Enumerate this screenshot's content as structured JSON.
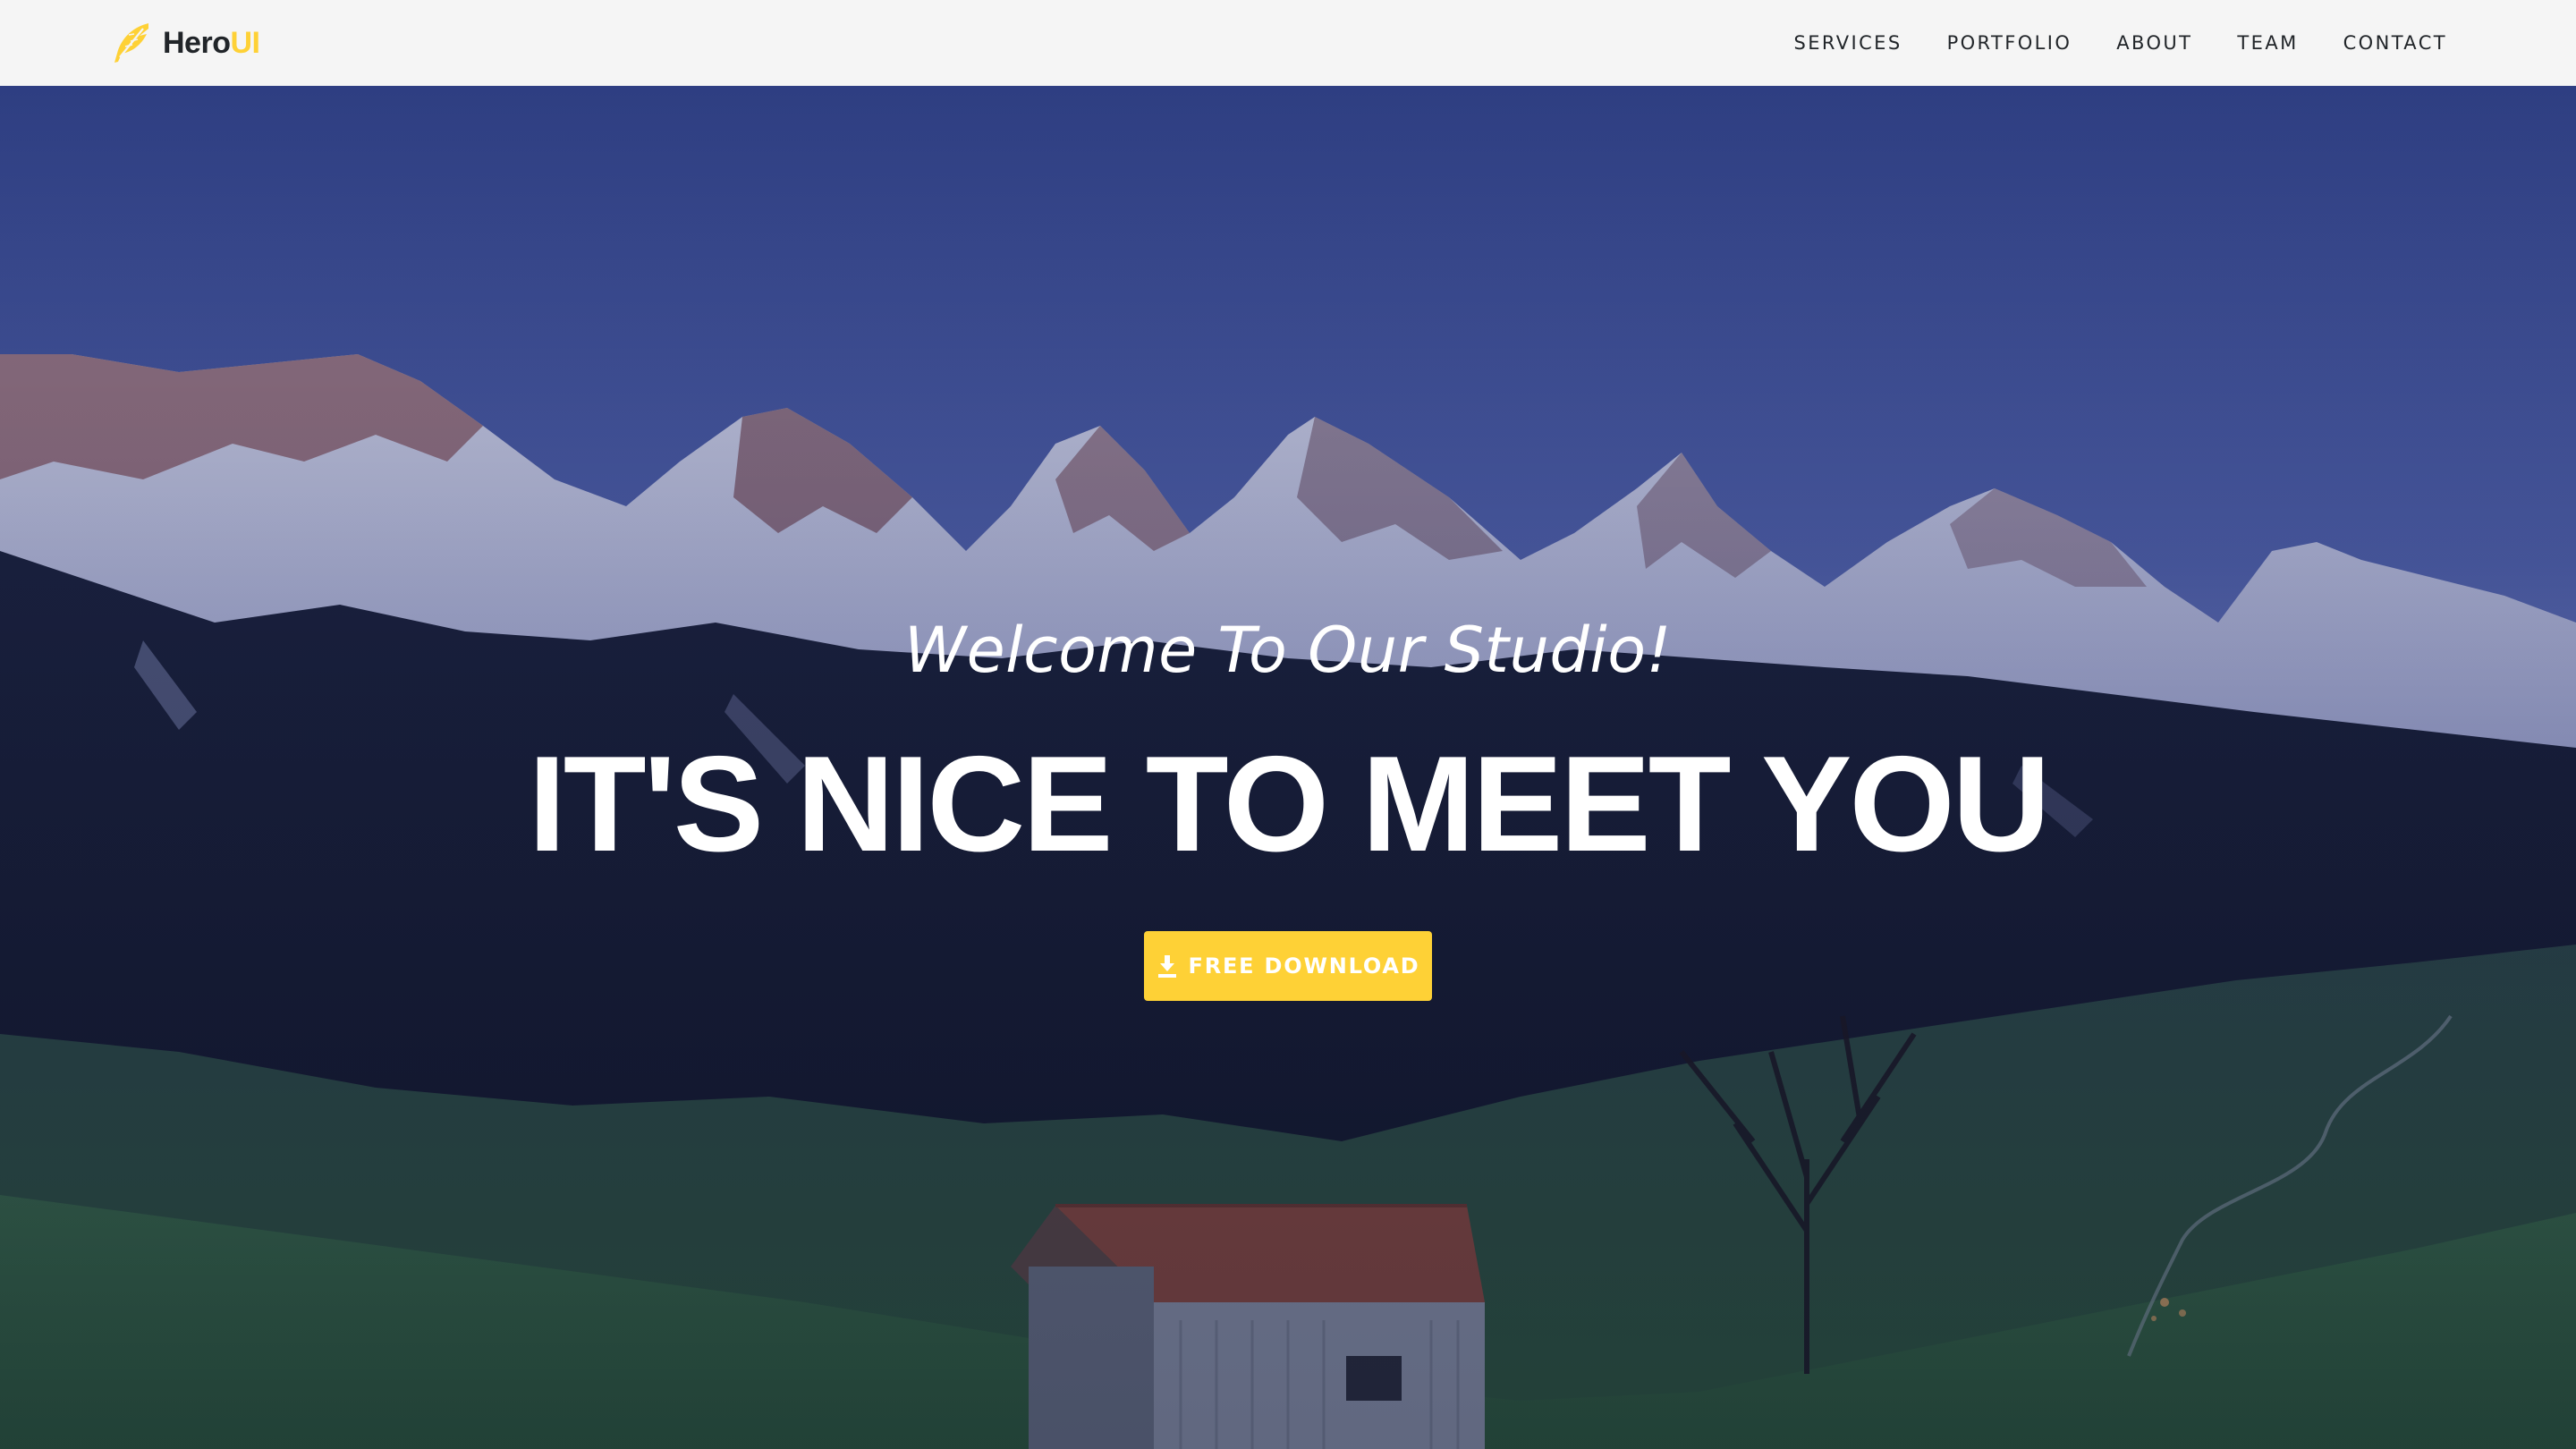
{
  "brand": {
    "name": "Hero",
    "accent": "UI",
    "icon": "feather-icon",
    "accent_color": "#fed136"
  },
  "nav": {
    "items": [
      {
        "label": "SERVICES"
      },
      {
        "label": "PORTFOLIO"
      },
      {
        "label": "ABOUT"
      },
      {
        "label": "TEAM"
      },
      {
        "label": "CONTACT"
      }
    ]
  },
  "hero": {
    "subheading": "Welcome To Our Studio!",
    "heading": "IT'S NICE TO MEET YOU",
    "button": {
      "label": "FREE DOWNLOAD",
      "icon": "download-icon",
      "color": "#fed136"
    },
    "background": "mountain-landscape-image"
  }
}
